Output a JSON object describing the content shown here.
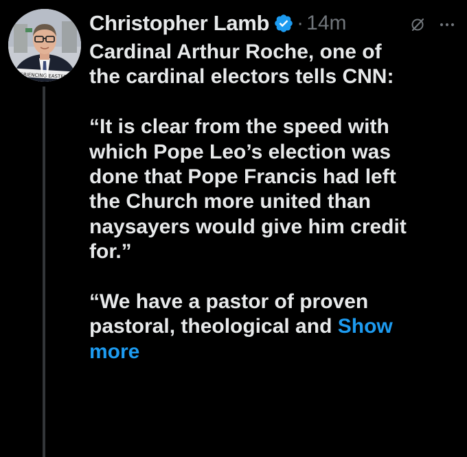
{
  "tweet": {
    "author": {
      "name": "Christopher Lamb",
      "verified_icon": "verified-badge-icon",
      "avatar_banner_text": "EXPERIENCING EASTER WE"
    },
    "separator": "·",
    "time": "14m",
    "grok_icon": "grok-icon",
    "more_icon": "more-options-icon",
    "text": {
      "lines": [
        "Cardinal Arthur Roche, one of",
        "the cardinal electors tells CNN:",
        "“It is clear from the speed with",
        "which Pope Leo’s election was",
        "done that Pope Francis had left",
        "the Church more united than",
        "naysayers would give him credit",
        "for.”",
        "“We have a pastor of proven",
        "pastoral, theological and ",
        "more"
      ],
      "show_more_first": "Show"
    }
  },
  "colors": {
    "background": "#000000",
    "text": "#e7e9ea",
    "muted": "#71767b",
    "accent": "#1d9bf0"
  }
}
